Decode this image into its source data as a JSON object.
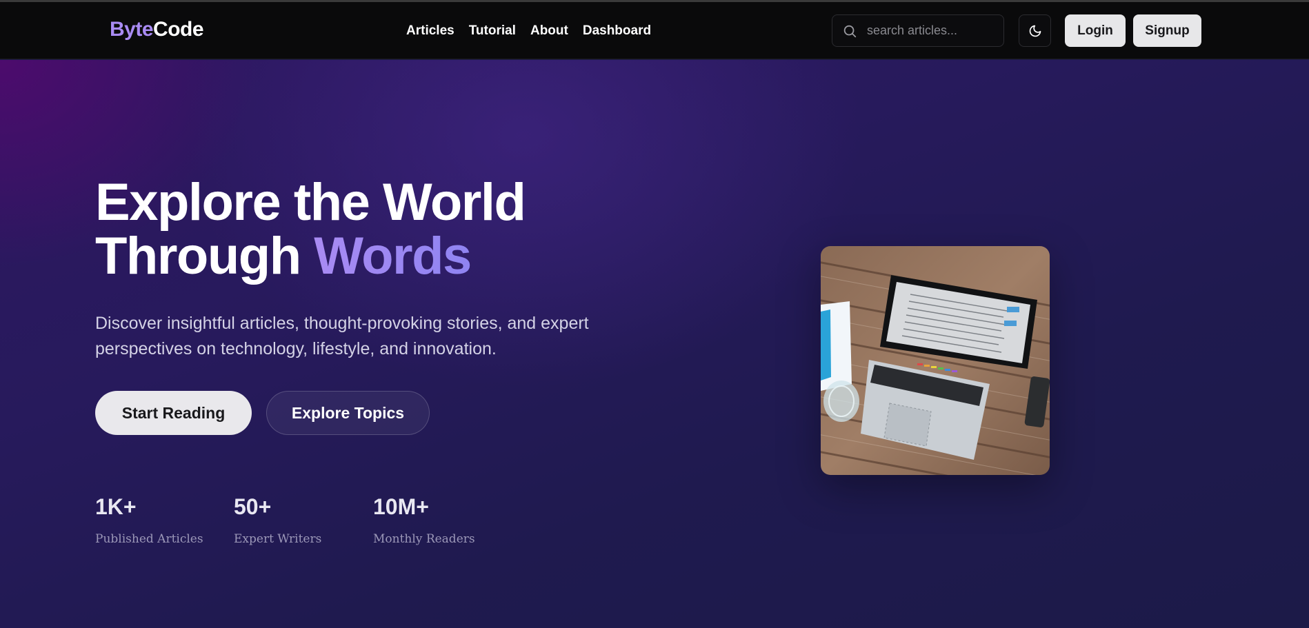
{
  "brand": {
    "part1": "Byte",
    "part2": "Code"
  },
  "nav": {
    "links": [
      "Articles",
      "Tutorial",
      "About",
      "Dashboard"
    ]
  },
  "search": {
    "placeholder": "search articles..."
  },
  "auth": {
    "login": "Login",
    "signup": "Signup"
  },
  "hero": {
    "headline_line1": "Explore the World",
    "headline_line2_plain": "Through ",
    "headline_line2_accent": "Words",
    "subtitle": "Discover insightful articles, thought-provoking stories, and expert perspectives on technology, lifestyle, and innovation.",
    "primary_cta": "Start Reading",
    "secondary_cta": "Explore Topics",
    "stats": [
      {
        "value": "1K+",
        "label": "Published Articles"
      },
      {
        "value": "50+",
        "label": "Expert Writers"
      },
      {
        "value": "10M+",
        "label": "Monthly Readers"
      }
    ]
  },
  "colors": {
    "accent": "#a98bf3",
    "navbar_bg": "#0a0a0b",
    "button_light": "#e7e7e9"
  },
  "icons": {
    "search": "search-icon",
    "theme": "moon-icon"
  }
}
